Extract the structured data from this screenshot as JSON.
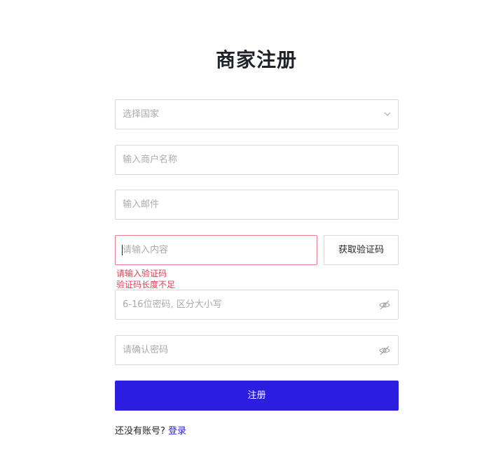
{
  "page": {
    "title": "商家注册"
  },
  "form": {
    "country_placeholder": "选择国家",
    "merchant_name_placeholder": "输入商户名称",
    "email_placeholder": "输入邮件",
    "code_placeholder": "请输入内容",
    "get_code_label": "获取验证码",
    "errors": [
      "请输入验证码",
      "验证码长度不足"
    ],
    "password_placeholder": "6-16位密码, 区分大小写",
    "confirm_password_placeholder": "请确认密码",
    "submit_label": "注册"
  },
  "footer": {
    "prompt": "还没有账号?",
    "login_label": "登录"
  },
  "colors": {
    "primary": "#2b1ede",
    "error": "#e23d53",
    "border": "#d8d8d8",
    "placeholder": "#a8abb2"
  },
  "icons": {
    "country_select": "chevron-down-icon",
    "password_toggle": "eye-off-icon",
    "confirm_toggle": "eye-off-icon"
  }
}
